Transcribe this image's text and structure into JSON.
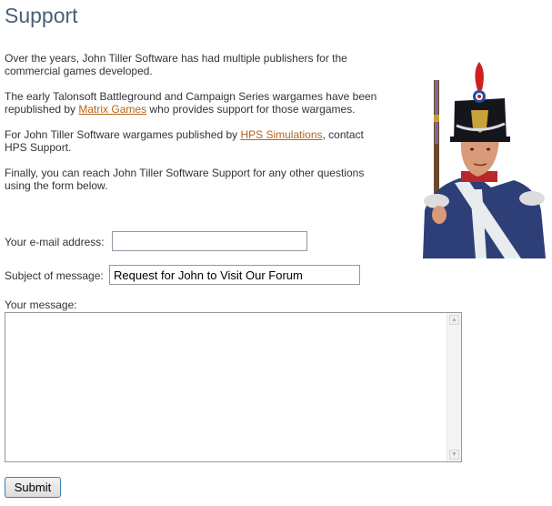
{
  "page": {
    "title": "Support",
    "paragraphs": {
      "p1": "Over the years, John Tiller Software has had multiple publishers for the commercial games developed.",
      "p2_before": "The early Talonsoft Battleground and Campaign Series wargames have been republished by ",
      "p2_link": "Matrix Games",
      "p2_after": " who provides support for those wargames.",
      "p3_before": "For John Tiller Software wargames published by ",
      "p3_link": "HPS Simulations",
      "p3_after": ", contact HPS Support.",
      "p4": "Finally, you can reach John Tiller Software Support for any other questions using the form below."
    }
  },
  "form": {
    "email_label": "Your e-mail address:",
    "email_value": "",
    "subject_label": "Subject of message:",
    "subject_value": "Request for John to Visit Our Forum",
    "message_label": "Your message:",
    "message_value": "",
    "submit_label": "Submit"
  },
  "colors": {
    "title": "#4a5f78",
    "link": "#b8641a",
    "text": "#333333"
  }
}
